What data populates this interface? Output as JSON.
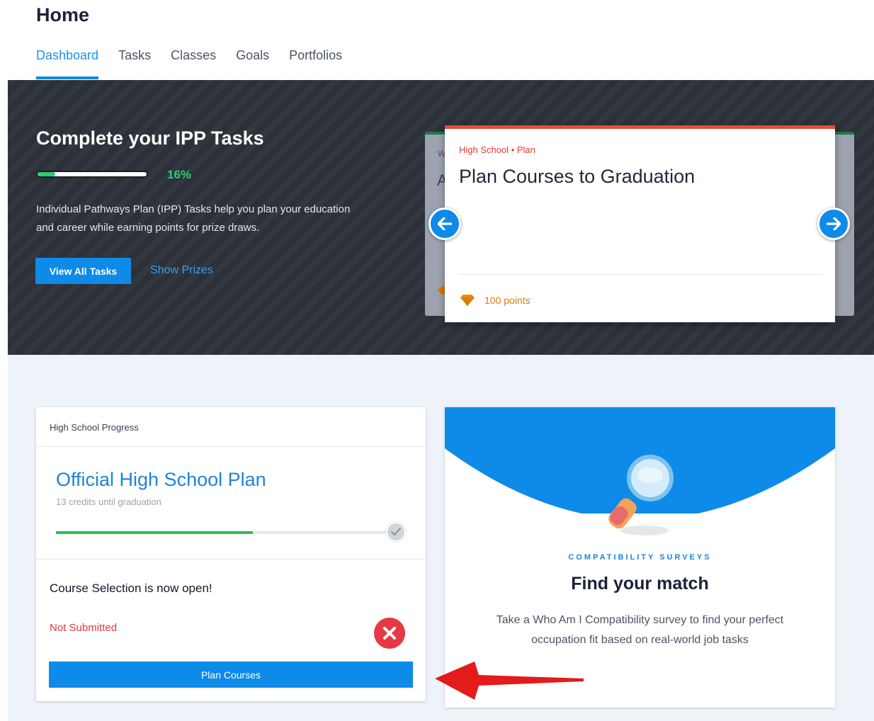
{
  "header": {
    "title": "Home",
    "tabs": [
      {
        "label": "Dashboard",
        "active": true
      },
      {
        "label": "Tasks"
      },
      {
        "label": "Classes"
      },
      {
        "label": "Goals"
      },
      {
        "label": "Portfolios"
      }
    ]
  },
  "banner": {
    "title": "Complete your IPP Tasks",
    "progress_percent": 16,
    "progress_label": "16%",
    "description": "Individual Pathways Plan (IPP) Tasks help you plan your education and career while earning points for prize draws.",
    "view_all_label": "View All Tasks",
    "show_prizes_label": "Show Prizes"
  },
  "task_card": {
    "category": "High School • Plan",
    "title": "Plan Courses to Graduation",
    "points_label": "100 points",
    "peek_category": "W",
    "peek_title": "A"
  },
  "hs_progress": {
    "header": "High School Progress",
    "plan_title": "Official High School Plan",
    "credits_text": "13 credits until graduation",
    "progress_fraction": 0.58,
    "course_selection": "Course Selection is now open!",
    "status": "Not Submitted",
    "plan_button_label": "Plan Courses"
  },
  "survey": {
    "kicker": "COMPATIBILITY SURVEYS",
    "title": "Find your match",
    "description": "Take a Who Am I Compatibility survey to find your perfect occupation fit based on real-world job tasks"
  },
  "colors": {
    "primary": "#0e8ae8",
    "success": "#2ecc71",
    "danger": "#e53935",
    "points": "#e07b00"
  },
  "icons": {
    "prev": "arrow-left-icon",
    "next": "arrow-right-icon",
    "points": "diamond-icon",
    "complete": "check-icon",
    "not_submitted": "close-circle-icon",
    "survey": "magnifying-glass-icon"
  }
}
